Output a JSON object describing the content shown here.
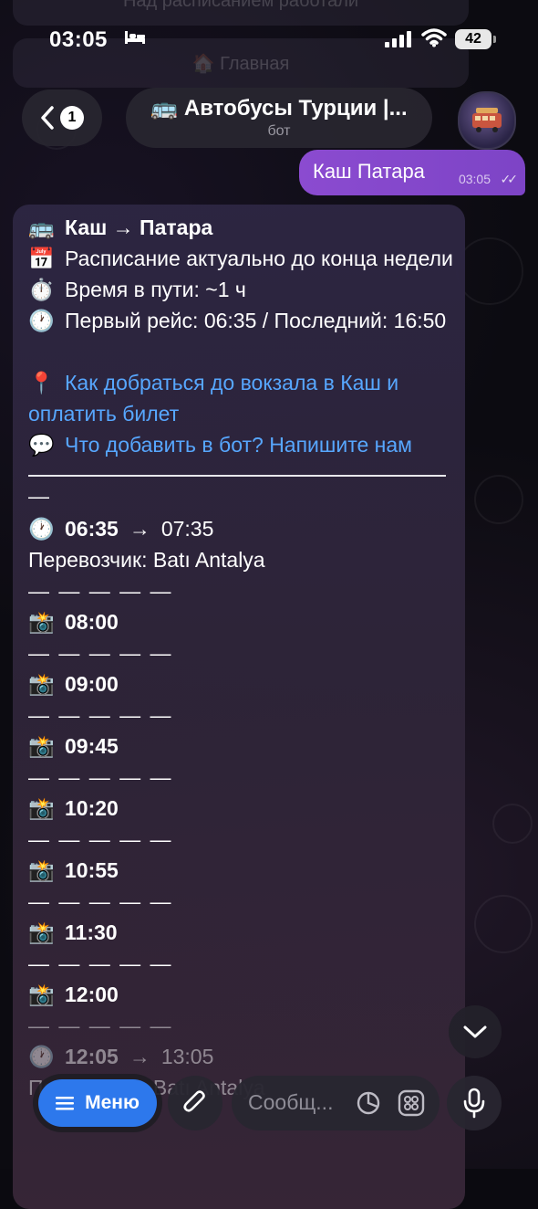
{
  "status_bar": {
    "time": "03:05",
    "battery": "42"
  },
  "header": {
    "back_unread_count": "1",
    "chat_title": "🚌 Автобусы Турции |...",
    "chat_subtitle": "бот"
  },
  "background_ghost": {
    "top_line": "Над расписанием работали",
    "main_label": "🏠 Главная"
  },
  "outgoing_message": {
    "text": "Каш Патара",
    "time": "03:05"
  },
  "incoming_message": {
    "route_emoji": "🚌",
    "route": "Каш → Патара",
    "calendar_emoji": "📅",
    "schedule_note": "Расписание актуально до конца недели",
    "stopwatch_emoji": "⏱️",
    "travel_time": "Время в пути: ~1 ч",
    "clock_emoji": "🕐",
    "first_last": "Первый рейс: 06:35 / Последний: 16:50",
    "pin_emoji": "📍",
    "link_station": "Как добраться до вокзала в Каш и оплатить билет",
    "speech_emoji": "💬",
    "link_feedback": "Что добавить в бот? Напишите нам",
    "after_rule": "—",
    "separator": "— — — — —",
    "trips": [
      {
        "icon": "🕐",
        "time": "06:35",
        "arrow": "→",
        "arrival": "07:35"
      },
      {
        "carrier": "Перевозчик: Batı Antalya"
      },
      {
        "icon": "📸",
        "time": "08:00"
      },
      {
        "icon": "📸",
        "time": "09:00"
      },
      {
        "icon": "📸",
        "time": "09:45"
      },
      {
        "icon": "📸",
        "time": "10:20"
      },
      {
        "icon": "📸",
        "time": "10:55"
      },
      {
        "icon": "📸",
        "time": "11:30"
      },
      {
        "icon": "📸",
        "time": "12:00"
      },
      {
        "icon": "🕐",
        "time": "12:05",
        "arrow": "→",
        "arrival": "13:05"
      },
      {
        "carrier": "Перевозчик: Batı Antalya"
      }
    ]
  },
  "input_bar": {
    "menu_label": "Меню",
    "placeholder": "Сообщ..."
  }
}
